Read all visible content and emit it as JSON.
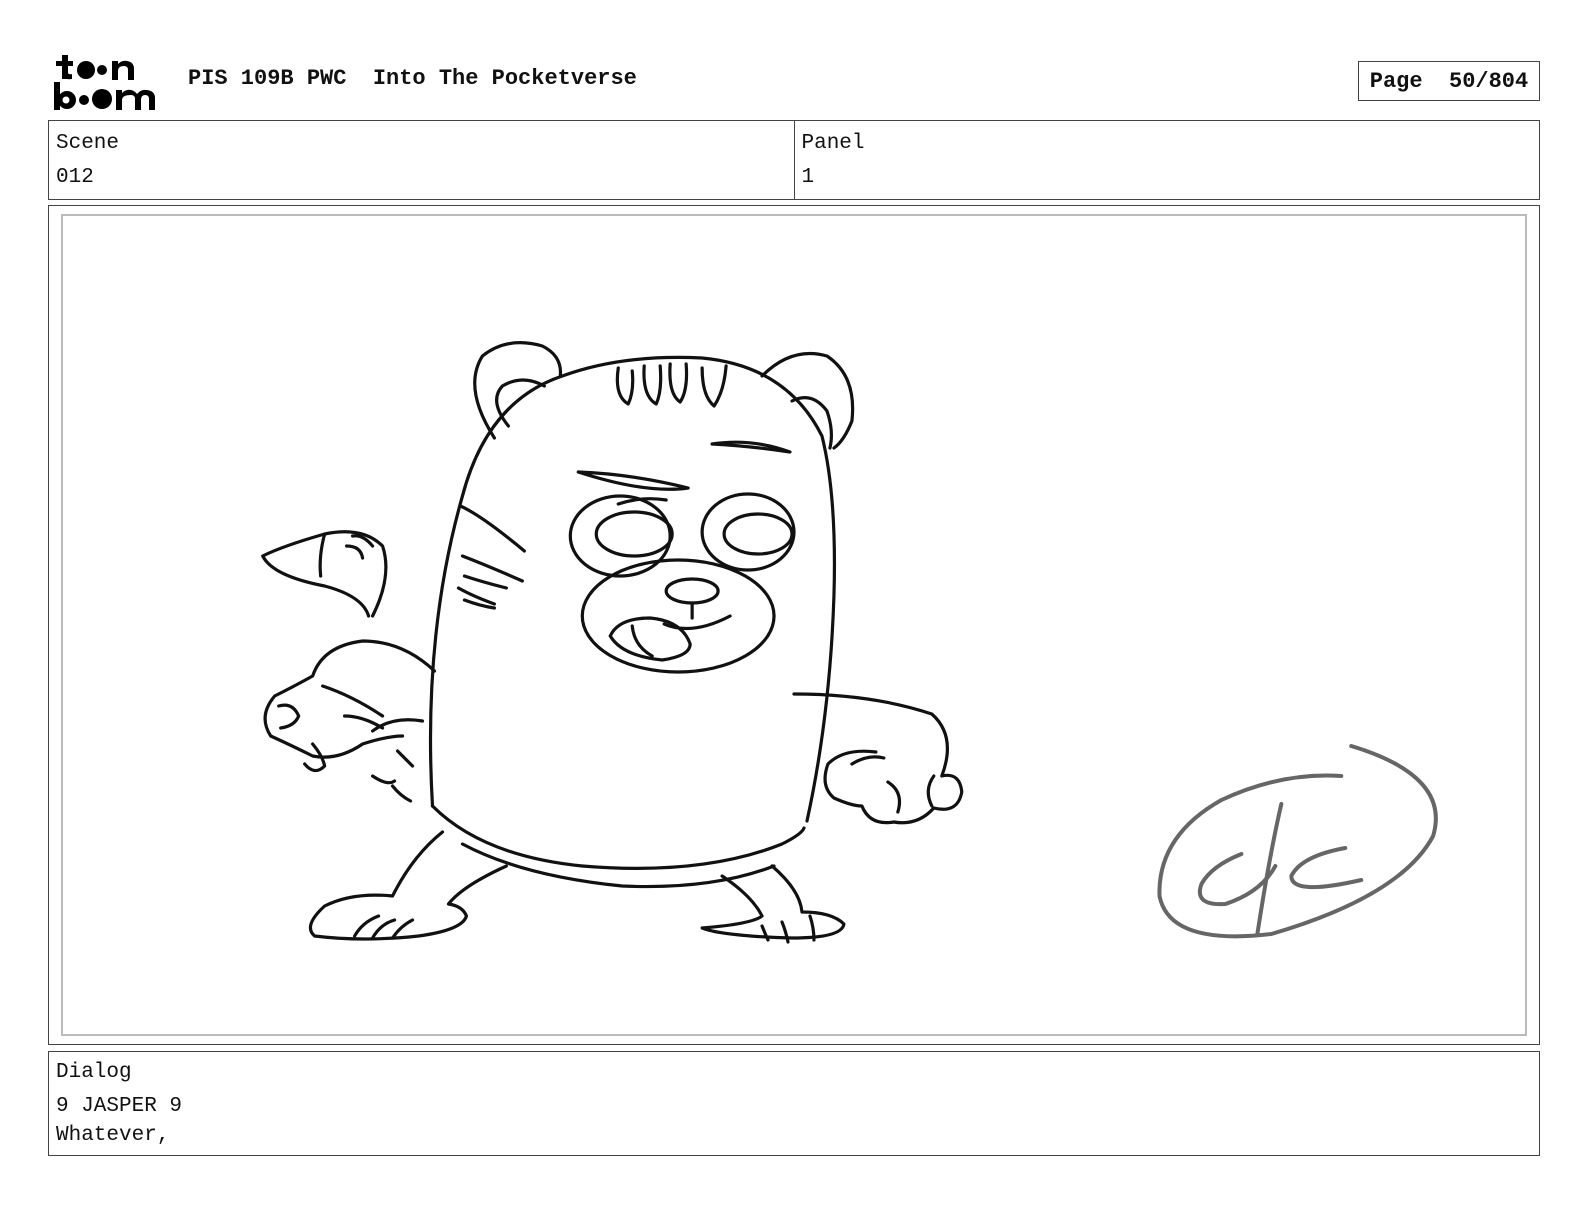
{
  "header": {
    "logo_text": "toon boom",
    "production_title": "PIS 109B PWC  Into The Pocketverse",
    "page_label": "Page  50/804"
  },
  "scene": {
    "label": "Scene",
    "value": "012"
  },
  "panel": {
    "label": "Panel",
    "value": "1"
  },
  "frame": {
    "content": "storyboard-sketch",
    "signature_initials": "dc"
  },
  "dialog": {
    "label": "Dialog",
    "speaker": "9 JASPER 9",
    "line": "Whatever,"
  }
}
